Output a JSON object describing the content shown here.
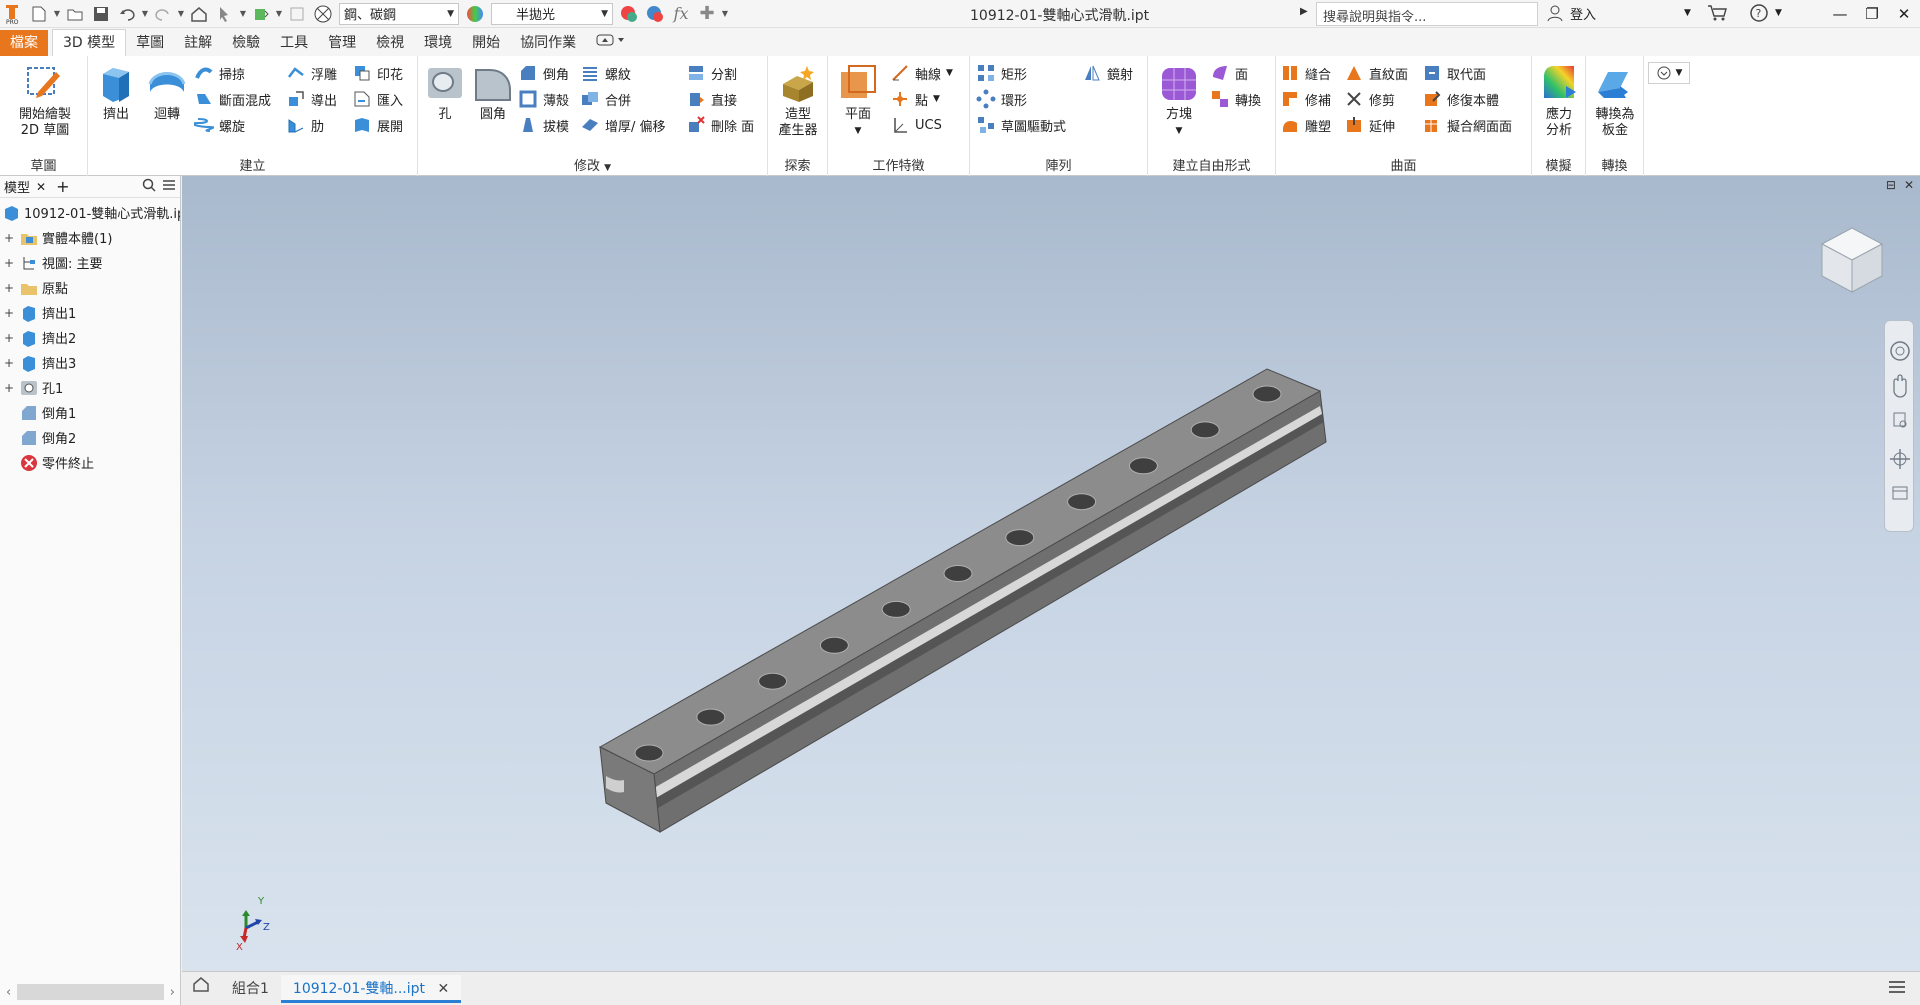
{
  "titlebar": {
    "material": "鋼、碳鋼",
    "appearance": "半拋光",
    "document_title": "10912-01-雙軸心式滑軌.ipt",
    "help_search_placeholder": "搜尋說明與指令...",
    "signin": "登入"
  },
  "tabs": [
    "檔案",
    "3D 模型",
    "草圖",
    "註解",
    "檢驗",
    "工具",
    "管理",
    "檢視",
    "環境",
    "開始",
    "協同作業"
  ],
  "active_tab": "3D 模型",
  "ribbon": {
    "sketch": {
      "title": "草圖",
      "start_sketch": "開始繪製",
      "start_sketch_2": "2D 草圖"
    },
    "create": {
      "title": "建立",
      "extrude": "擠出",
      "revolve": "迴轉",
      "sweep": "掃掠",
      "loft": "斷面混成",
      "coil": "螺旋",
      "emboss": "浮雕",
      "derive": "導出",
      "rib": "肋",
      "decal": "印花",
      "import": "匯入",
      "unwrap": "展開"
    },
    "modify": {
      "title": "修改",
      "hole": "孔",
      "fillet": "圓角",
      "chamfer": "倒角",
      "shell": "薄殼",
      "draft": "拔模",
      "thread": "螺紋",
      "combine": "合併",
      "thicken": "增厚/ 偏移",
      "split": "分割",
      "direct": "直接",
      "delete_face": "刪除 面"
    },
    "explore": {
      "title": "探索",
      "shape_generator": "造型",
      "shape_generator_2": "產生器"
    },
    "work_features": {
      "title": "工作特徵",
      "plane": "平面",
      "axis": "軸線",
      "point": "點",
      "ucs": "UCS"
    },
    "pattern": {
      "title": "陣列",
      "rectangular": "矩形",
      "circular": "環形",
      "sketch_driven": "草圖驅動式",
      "mirror": "鏡射"
    },
    "freeform": {
      "title": "建立自由形式",
      "box": "方塊",
      "face": "面",
      "convert": "轉換"
    },
    "surface": {
      "title": "曲面",
      "stitch": "縫合",
      "patch": "修補",
      "sculpt": "雕塑",
      "ruled": "直紋面",
      "trim": "修剪",
      "extend": "延伸",
      "replace_face": "取代面",
      "repair_bodies": "修復本體",
      "fit_mesh_face": "擬合網面面"
    },
    "simulation": {
      "title": "模擬",
      "stress": "應力",
      "stress_2": "分析"
    },
    "convert": {
      "title": "轉換",
      "to_sheet_metal": "轉換為",
      "to_sheet_metal_2": "板金"
    }
  },
  "browser": {
    "tab": "模型",
    "add": "+",
    "root": "10912-01-雙軸心式滑軌.ipt",
    "nodes": [
      "實體本體(1)",
      "視圖: 主要",
      "原點",
      "擠出1",
      "擠出2",
      "擠出3",
      "孔1",
      "倒角1",
      "倒角2",
      "零件終止"
    ]
  },
  "axis_labels": {
    "x": "X",
    "y": "Y",
    "z": "Z"
  },
  "doc_tabs": [
    "組合1",
    "10912-01-雙軸...ipt"
  ],
  "colors": {
    "file_tab": "#e8761c",
    "accent": "#2a7fd4"
  }
}
